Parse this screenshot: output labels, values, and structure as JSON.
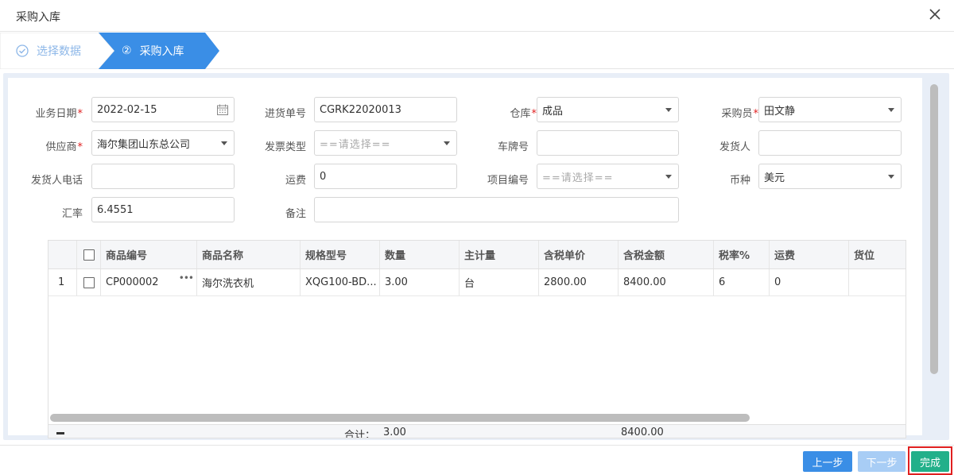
{
  "dialog": {
    "title": "采购入库"
  },
  "steps": [
    {
      "label": "选择数据",
      "state": "done"
    },
    {
      "number": "②",
      "label": "采购入库",
      "state": "active"
    }
  ],
  "form": {
    "biz_date": {
      "label": "业务日期",
      "value": "2022-02-15",
      "required": "*"
    },
    "receipt_no": {
      "label": "进货单号",
      "value": "CGRK22020013"
    },
    "warehouse": {
      "label": "仓库",
      "value": "成品",
      "required": "*"
    },
    "buyer": {
      "label": "采购员",
      "value": "田文静",
      "required": "*"
    },
    "supplier": {
      "label": "供应商",
      "value": "海尔集团山东总公司",
      "required": "*"
    },
    "invoice_type": {
      "label": "发票类型",
      "placeholder": "==请选择=="
    },
    "plate_no": {
      "label": "车牌号",
      "value": ""
    },
    "shipper": {
      "label": "发货人",
      "value": ""
    },
    "shipper_phone": {
      "label": "发货人电话",
      "value": ""
    },
    "freight": {
      "label": "运费",
      "value": "0"
    },
    "project_no": {
      "label": "项目编号",
      "placeholder": "==请选择=="
    },
    "currency": {
      "label": "币种",
      "value": "美元"
    },
    "exchange_rate": {
      "label": "汇率",
      "value": "6.4551"
    },
    "remark": {
      "label": "备注",
      "value": ""
    }
  },
  "grid": {
    "columns": [
      "商品编号",
      "商品名称",
      "规格型号",
      "数量",
      "主计量",
      "含税单价",
      "含税金额",
      "税率%",
      "运费",
      "货位"
    ],
    "rows": [
      {
        "index": "1",
        "code": "CP000002",
        "name": "海尔洗衣机",
        "spec": "XQG100-BD...",
        "qty": "3.00",
        "unit": "台",
        "price": "2800.00",
        "amount": "8400.00",
        "tax": "6",
        "freight": "0",
        "location": ""
      }
    ],
    "footer": {
      "label": "合计：",
      "qty": "3.00",
      "amount": "8400.00"
    }
  },
  "buttons": {
    "prev": "上一步",
    "next": "下一步",
    "done": "完成"
  },
  "colors": {
    "accent": "#3a8ee6",
    "success": "#22b08a",
    "highlight": "#e02020"
  }
}
